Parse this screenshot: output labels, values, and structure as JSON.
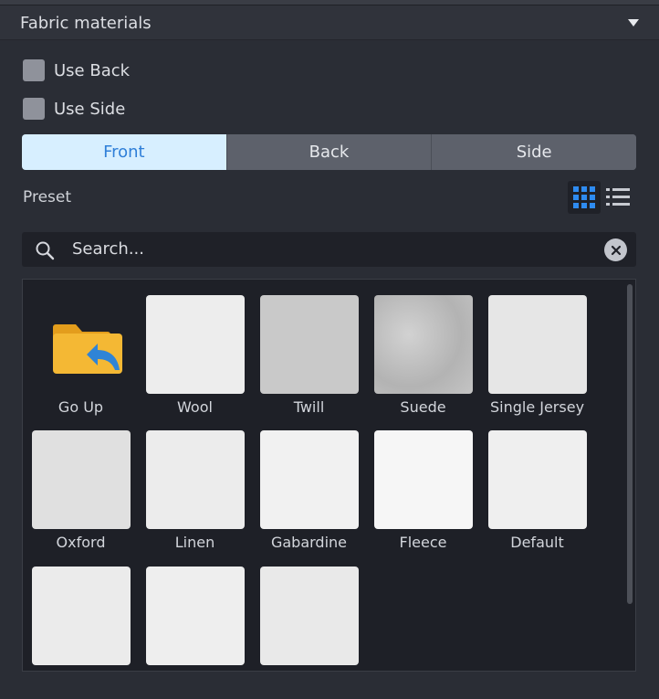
{
  "header": {
    "title": "Fabric materials",
    "collapse_icon": "caret-down-icon"
  },
  "options": {
    "use_back": {
      "label": "Use Back",
      "checked": false
    },
    "use_side": {
      "label": "Use Side",
      "checked": false
    }
  },
  "side_tabs": [
    {
      "label": "Front",
      "active": true
    },
    {
      "label": "Back",
      "active": false
    },
    {
      "label": "Side",
      "active": false
    }
  ],
  "preset": {
    "label": "Preset",
    "view_mode": "grid"
  },
  "search": {
    "placeholder": "Search..."
  },
  "items": [
    {
      "label": "Go Up",
      "type": "folder-up"
    },
    {
      "label": "Wool",
      "color": "#ededed"
    },
    {
      "label": "Twill",
      "color": "#c9c9c9"
    },
    {
      "label": "Suede",
      "color": "#bdbdbd"
    },
    {
      "label": "Single Jersey",
      "color": "#e6e6e6"
    },
    {
      "label": "Oxford",
      "color": "#e0e0e0"
    },
    {
      "label": "Linen",
      "color": "#ececec"
    },
    {
      "label": "Gabardine",
      "color": "#f1f1f1"
    },
    {
      "label": "Fleece",
      "color": "#f6f6f6"
    },
    {
      "label": "Default",
      "color": "#efefef"
    },
    {
      "label": "",
      "color": "#ebebeb"
    },
    {
      "label": "",
      "color": "#eeeeee"
    },
    {
      "label": "",
      "color": "#e9e9e9"
    }
  ],
  "colors": {
    "accent": "#2e8bf0",
    "active_tab_bg": "#d7efff",
    "folder": "#f2b632",
    "folder_arrow": "#2f84d6"
  }
}
